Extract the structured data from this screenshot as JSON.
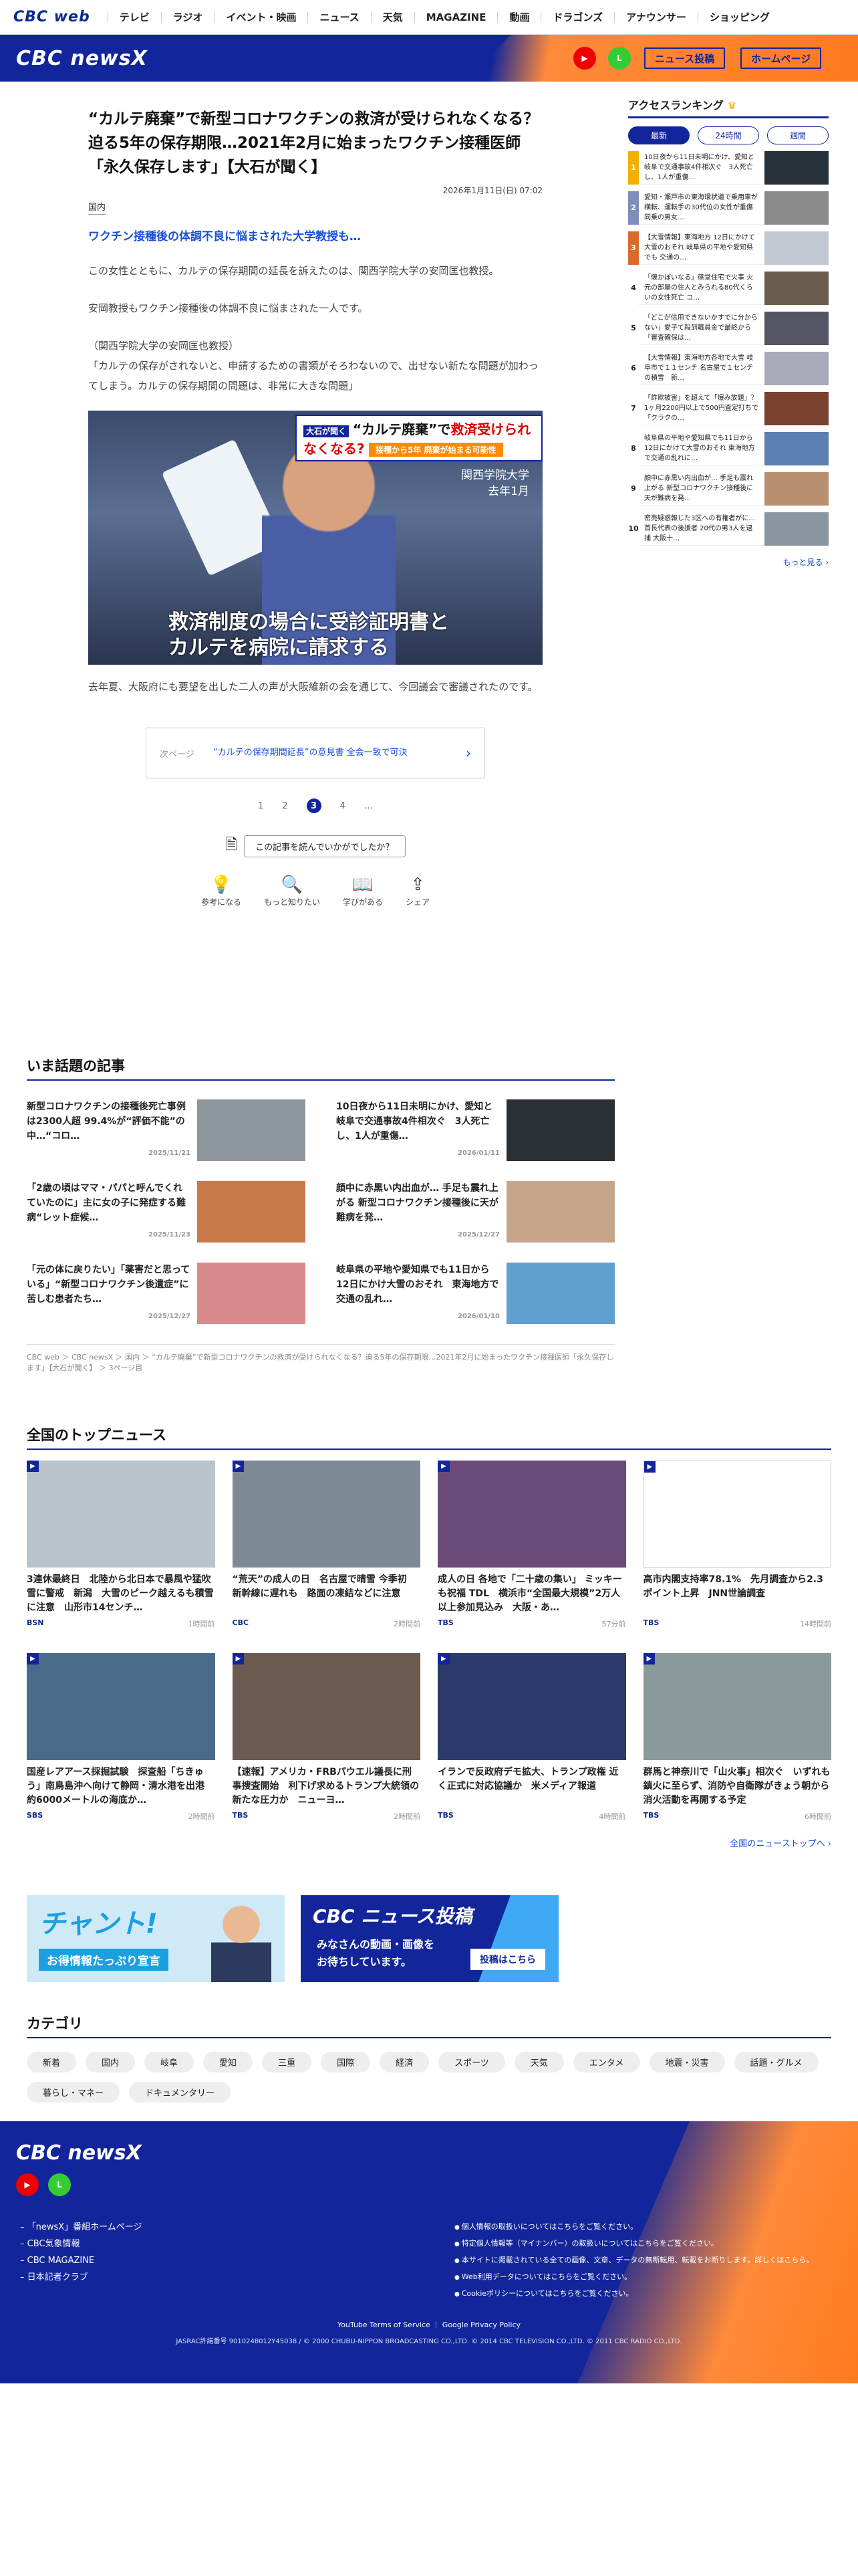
{
  "topnav": {
    "logo": "CBC web",
    "items": [
      "テレビ",
      "ラジオ",
      "イベント・映画",
      "ニュース",
      "天気",
      "MAGAZINE",
      "動画",
      "ドラゴンズ",
      "アナウンサー",
      "ショッピング"
    ]
  },
  "header": {
    "brand": "CBC newsX",
    "youtube": "YouTube",
    "line": "LINE",
    "post_btn": "ニュース投稿",
    "home_btn": "ホームページ"
  },
  "article": {
    "headline": "“カルテ廃棄”で新型コロナワクチンの救済が受けられなくなる？迫る5年の保存期限…2021年2月に始まったワクチン接種医師「永久保存します」【大石が聞く】",
    "date": "2026年1月11日(日) 07:02",
    "category": "国内",
    "subhead": "ワクチン接種後の体調不良に悩まされた大学教授も…",
    "p1": "この女性とともに、カルテの保存期間の延長を訴えたのは、関西学院大学の安岡匡也教授。",
    "p2": "安岡教授もワクチン接種後の体調不良に悩まされた一人です。",
    "p3a": "（関西学院大学の安岡匡也教授）",
    "p3b": "「カルテの保存がされないと、申請するための書類がそろわないので、出せない新たな問題が加わってしまう。カルテの保存期間の問題は、非常に大きな問題」",
    "photo": {
      "badge": "大石が聞く",
      "title_pre": "“カルテ廃棄”で",
      "title_red": "救済受けられなくなる?",
      "strip": "接種から5年 廃棄が始まる可能性",
      "loc1": "関西学院大学",
      "loc2": "去年1月",
      "cap1": "救済制度の場合に受診証明書と",
      "cap2": "カルテを病院に請求する"
    },
    "p4": "去年夏、大阪府にも要望を出した二人の声が大阪維新の会を通じて、今回議会で審議されたのです。",
    "next": {
      "label": "次ページ",
      "title": "“カルテの保存期間延長”の意見書 全会一致で可決"
    },
    "pager": [
      "1",
      "2",
      "3",
      "4",
      "…"
    ],
    "feedback": "この記事を読んでいかがでしたか？",
    "reactions": [
      "参考になる",
      "もっと知りたい",
      "学びがある",
      "シェア"
    ]
  },
  "ranking": {
    "title": "アクセスランキング",
    "tabs": [
      "最新",
      "24時間",
      "週間"
    ],
    "items": [
      "10日夜から11日未明にかけ、愛知と岐阜で交通事故4件相次ぐ　3人死亡し、1人が重傷…",
      "愛知・瀬戸市の東海環状道で乗用車が横転、運転手の30代位の女性が重傷　同乗の男女…",
      "【大雪情報】東海地方 12日にかけて大雪のおそれ 岐阜県の平地や愛知県でも 交通の…",
      "「懐かぼいなる」篠堂住宅で火事 火元の部屋の住人とみられる80代くらいの女性死亡 コ…",
      "「どこが信用できないかすでに分からない」愛子て殺到職員金で最終から「審査確保は…",
      "【大雪情報】東海地方各地で大雪 岐阜市で１１センチ 名古屋で１センチの積雪　新…",
      "「詐欺被害」を超えて「爆み放題」？ 1ヶ月2200円以上で500円査定打ちで「クラクの…",
      "岐阜県の平地や愛知県でも11日から12日にかけて大雪のおそれ 東海地方で交通の乱れに…",
      "顔中に赤黒い内出血が… 手足も震れ上がる 新型コロナワクチン接種後に天が難病を発…",
      "密売疑惑報じた3区への有権者がに…　首長代表の後援者 20代の男3人を逮捕 大阪十…"
    ],
    "more": "もっと見る"
  },
  "popular": {
    "title": "いま話題の記事",
    "items": [
      {
        "t": "新型コロナワクチンの接種後死亡事例は2300人超 99.4%が“評価不能”の中…“コロ…",
        "d": "2025/11/21"
      },
      {
        "t": "10日夜から11日未明にかけ、愛知と岐阜で交通事故4件相次ぐ　3人死亡し、1人が重傷…",
        "d": "2026/01/11"
      },
      {
        "t": "「2歳の頃はママ・パパと呼んでくれていたのに」主に女の子に発症する難病“レット症候…",
        "d": "2025/11/23"
      },
      {
        "t": "顔中に赤黒い内出血が… 手足も震れ上がる 新型コロナワクチン接種後に天が難病を発…",
        "d": "2025/12/27"
      },
      {
        "t": "「元の体に戻りたい」「薬害だと思っている」“新型コロナワクチン後遺症”に苦しむ患者たち…",
        "d": "2025/12/27"
      },
      {
        "t": "岐阜県の平地や愛知県でも11日から12日にかけ大雪のおそれ　東海地方で交通の乱れ…",
        "d": "2026/01/10"
      }
    ],
    "breadcrumb": "CBC web ＞ CBC newsX ＞ 国内 ＞ “カルテ廃棄”で新型コロナワクチンの救済が受けられなくなる？迫る5年の保存期限…2021年2月に始まったワクチン接種医師「永久保存します」【大石が聞く】 ＞ 3ページ目"
  },
  "national": {
    "title": "全国のトップニュース",
    "items": [
      {
        "t": "3連休最終日　北陸から北日本で暴風や猛吹雪に警戒　新潟　大雪のピーク越えるも積雪に注意　山形市14センチ…",
        "s": "BSN",
        "a": "1時間前"
      },
      {
        "t": "“荒天”の成人の日　名古屋で晴雪 今季初　新幹線に遅れも　路面の凍結などに注意",
        "s": "CBC",
        "a": "2時間前"
      },
      {
        "t": "成人の日 各地で「二十歳の集い」 ミッキーも祝福 TDL　横浜市“全国最大規模”2万人以上参加見込み　大阪・あ…",
        "s": "TBS",
        "a": "57分前"
      },
      {
        "t": "高市内閣支持率78.1%　先月調査から2.3ポイント上昇　JNN世論調査",
        "s": "TBS",
        "a": "14時間前"
      },
      {
        "t": "国産レアアース採掘試験　探査船「ちきゅう」南鳥島沖へ向けて静岡・清水港を出港　約6000メートルの海底か…",
        "s": "SBS",
        "a": "2時間前"
      },
      {
        "t": "【速報】アメリカ・FRBパウエル議長に刑事捜査開始　利下げ求めるトランプ大統領の新たな圧力か　ニューヨ…",
        "s": "TBS",
        "a": "2時間前"
      },
      {
        "t": "イランで反政府デモ拡大、トランプ政権 近く正式に対応協議か　米メディア報道",
        "s": "TBS",
        "a": "4時間前"
      },
      {
        "t": "群馬と神奈川で「山火事」相次ぐ　いずれも鎮火に至らず、消防や自衛隊がきょう朝から消火活動を再開する予定",
        "s": "TBS",
        "a": "6時間前"
      }
    ],
    "more": "全国のニューストップへ"
  },
  "banners": {
    "chant_title": "チャント!",
    "chant_sub": "お得情報たっぷり宣言",
    "post_title": "CBC ニュース投稿",
    "post_sub1": "みなさんの動画・画像を",
    "post_sub2": "お待ちしています。",
    "post_btn": "投稿はこちら"
  },
  "categories": {
    "title": "カテゴリ",
    "items": [
      "新着",
      "国内",
      "岐阜",
      "愛知",
      "三重",
      "国際",
      "経済",
      "スポーツ",
      "天気",
      "エンタメ",
      "地震・災害",
      "話題・グルメ",
      "暮らし・マネー",
      "ドキュメンタリー"
    ]
  },
  "footer": {
    "brand": "CBC newsX",
    "links": [
      "「newsX」番組ホームページ",
      "CBC気象情報",
      "CBC MAGAZINE",
      "日本記者クラブ"
    ],
    "policies": [
      "個人情報の取扱いについてはこちらをご覧ください。",
      "特定個人情報等（マイナンバー）の取扱いについてはこちらをご覧ください。",
      "本サイトに掲載されている全ての画像、文章、データの無断転用、転載をお断りします。詳しくはこちら。",
      "Web利用データについてはこちらをご覧ください。",
      "Cookieポリシーについてはこちらをご覧ください。"
    ],
    "terms": "YouTube Terms of Service ｜ Google Privacy Policy",
    "copy": "JASRAC許諾番号 9010248012Y45038 / © 2000 CHUBU-NIPPON BROADCASTING CO.,LTD. © 2014 CBC TELEVISION CO.,LTD. © 2011 CBC RADIO CO.,LTD."
  },
  "colors": {
    "brand_blue": "#12259a",
    "accent_orange": "#ff8a3a",
    "link_blue": "#1a4fd6"
  }
}
